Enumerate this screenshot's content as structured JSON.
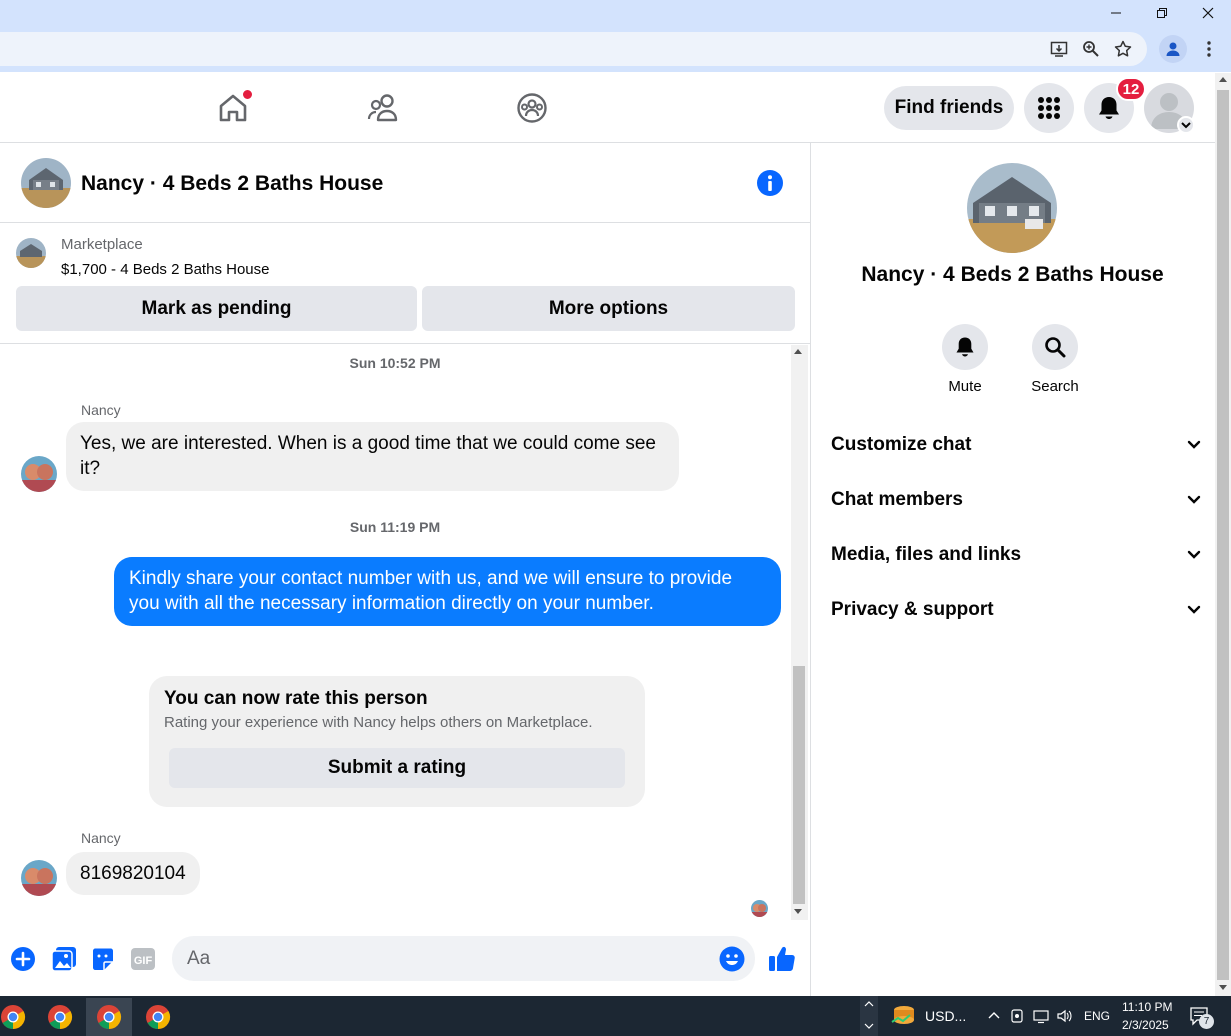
{
  "browser": {
    "window_buttons": [
      "minimize",
      "restore",
      "close"
    ],
    "toolbar_icons": [
      "install-icon",
      "zoom-icon",
      "bookmark-star-icon",
      "profile-icon",
      "menu-icon"
    ]
  },
  "header": {
    "find_friends_label": "Find friends",
    "notifications_count": "12"
  },
  "chat": {
    "title": "Nancy · 4 Beds 2 Baths House",
    "marketplace_label": "Marketplace",
    "listing": "$1,700 - 4 Beds 2 Baths House",
    "mark_pending_label": "Mark as pending",
    "more_options_label": "More options",
    "messages": [
      {
        "timestamp": "Sun 10:52 PM"
      },
      {
        "sender": "Nancy",
        "text": "Yes, we are interested. When is a good time that we could come see it?"
      },
      {
        "timestamp": "Sun 11:19 PM"
      },
      {
        "text_out": "Kindly share your contact number with us, and we will ensure to provide you with all the necessary information directly on your number."
      },
      {
        "sender": "Nancy",
        "text": "8169820104"
      }
    ],
    "rating": {
      "title": "You can now rate this person",
      "subtitle": "Rating your experience with Nancy helps others on Marketplace.",
      "button": "Submit a rating"
    },
    "composer_placeholder": "Aa"
  },
  "right_panel": {
    "title": "Nancy · 4 Beds 2 Baths House",
    "actions": [
      {
        "label": "Mute",
        "icon": "bell-icon"
      },
      {
        "label": "Search",
        "icon": "search-icon"
      }
    ],
    "sections": [
      "Customize chat",
      "Chat members",
      "Media, files and links",
      "Privacy & support"
    ]
  },
  "taskbar": {
    "currency": "USD...",
    "language": "ENG",
    "time": "11:10 PM",
    "date": "2/3/2025",
    "notification_count": "7"
  },
  "colors": {
    "accent": "#0a7cff",
    "fb_blue": "#0866ff",
    "badge_red": "#e41e3f"
  }
}
